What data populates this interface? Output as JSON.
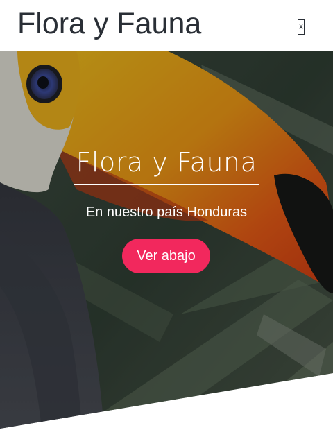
{
  "header": {
    "brand": "Flora y Fauna",
    "menu_icon": "menu-icon"
  },
  "hero": {
    "title": "Flora y Fauna",
    "subtitle": "En nuestro país Honduras",
    "button_label": "Ver abajo",
    "button_color": "#f2285d",
    "background_image": "toucan photo"
  }
}
